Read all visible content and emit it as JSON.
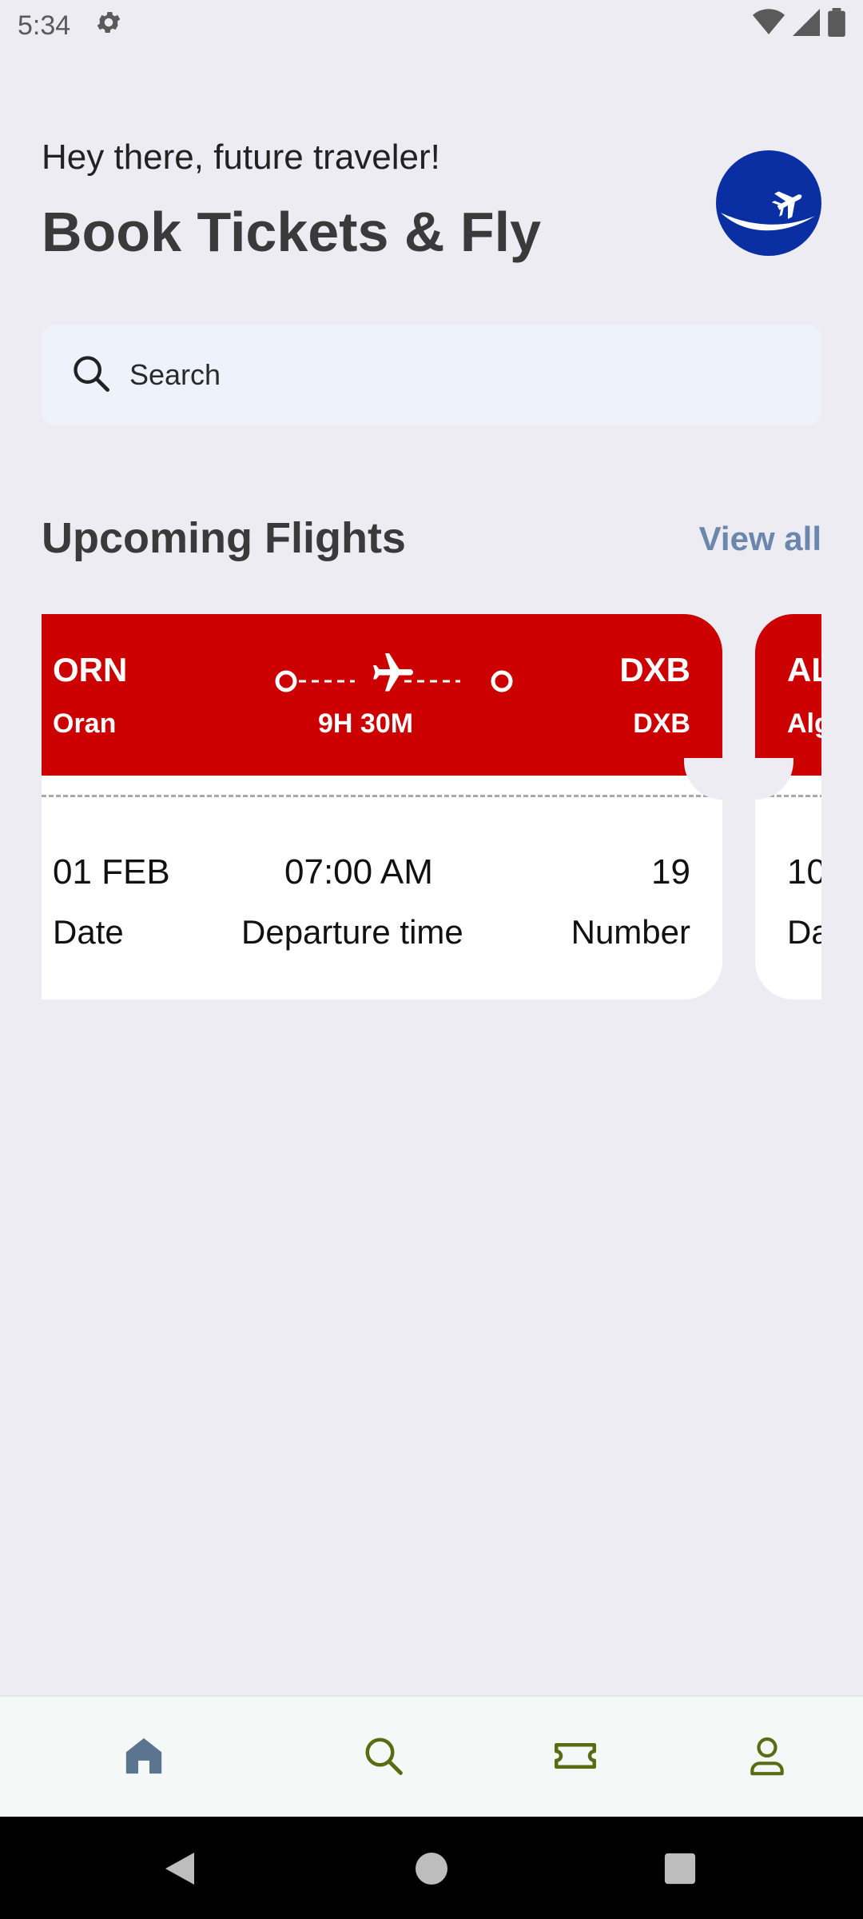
{
  "status_bar": {
    "time": "5:34"
  },
  "header": {
    "greeting": "Hey there, future traveler!",
    "headline": "Book Tickets & Fly"
  },
  "search": {
    "placeholder": "Search"
  },
  "section": {
    "title": "Upcoming Flights",
    "view_all": "View all"
  },
  "flights": [
    {
      "from_code": "ORN",
      "from_city": "Oran",
      "to_code": "DXB",
      "to_city": "DXB",
      "duration": "9H 30M",
      "date": "01 FEB",
      "date_label": "Date",
      "departure": "07:00 AM",
      "departure_label": "Departure time",
      "number": "19",
      "number_label": "Number"
    },
    {
      "from_code": "AL",
      "from_city": "Alg",
      "date": "10",
      "date_label": "Da"
    }
  ],
  "colors": {
    "card_accent": "#CC0000",
    "view_all": "#6B87AD",
    "nav_active": "#5B7490",
    "nav_inactive": "#5A6B12",
    "logo": "#0A2FA3"
  },
  "icons": {
    "status": [
      "gear-icon",
      "wifi-icon",
      "signal-icon",
      "battery-icon"
    ],
    "nav": [
      "home-icon",
      "search-icon",
      "ticket-icon",
      "profile-icon"
    ],
    "system": [
      "back-icon",
      "home-circle-icon",
      "recents-icon"
    ]
  }
}
